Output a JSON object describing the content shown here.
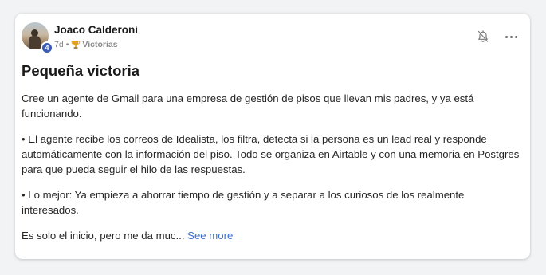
{
  "post": {
    "author": {
      "name": "Joaco Calderoni",
      "level": "4",
      "avatar_icon": "user-photo"
    },
    "meta": {
      "time_ago": "7d",
      "separator": "•",
      "category_icon": "trophy-icon",
      "category": "Victorias"
    },
    "title": "Pequeña victoria",
    "paragraphs": [
      "Cree un agente de Gmail para una empresa de gestión de pisos que llevan mis padres, y ya está funcionando.",
      "•   El agente recibe los correos de Idealista, los filtra, detecta si la persona es un lead real y responde automáticamente con la información del piso. Todo se organiza en Airtable y con una memoria en Postgres para que pueda seguir el hilo de las respuestas.",
      "•   Lo mejor: Ya empieza a ahorrar tiempo de gestión y a separar a los curiosos de los realmente interesados."
    ],
    "truncated_text": "Es solo el inicio, pero me da muc...",
    "see_more_label": "See more"
  },
  "actions": {
    "bell_icon": "bell-off-icon",
    "more_icon": "more-horizontal-icon"
  },
  "colors": {
    "link": "#3b6fd0",
    "badge": "#3b5bb5",
    "card_bg": "#ffffff",
    "page_bg": "#f2f3f5"
  }
}
